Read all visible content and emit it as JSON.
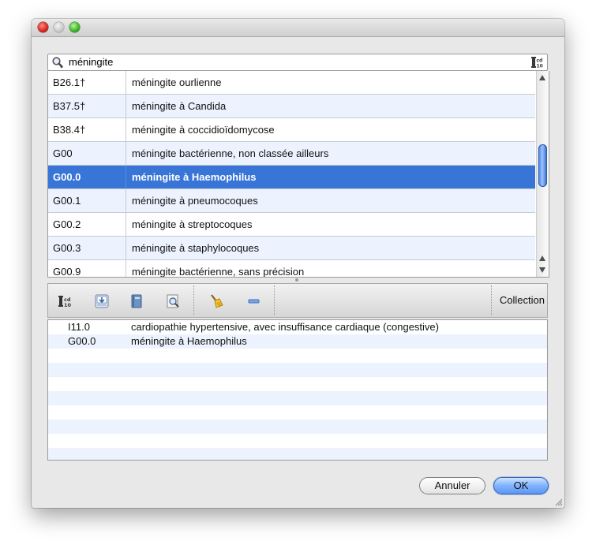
{
  "search": {
    "value": "méningite",
    "left_icon": "search-icon",
    "right_icon": "icd10-icon"
  },
  "results": {
    "rows": [
      {
        "code": "B26.1†",
        "description": "méningite ourlienne"
      },
      {
        "code": "B37.5†",
        "description": "méningite à Candida"
      },
      {
        "code": "B38.4†",
        "description": "méningite à coccidioïdomycose"
      },
      {
        "code": "G00",
        "description": "méningite bactérienne, non classée ailleurs"
      },
      {
        "code": "G00.0",
        "description": "méningite à Haemophilus"
      },
      {
        "code": "G00.1",
        "description": "méningite à pneumocoques"
      },
      {
        "code": "G00.2",
        "description": "méningite à streptocoques"
      },
      {
        "code": "G00.3",
        "description": "méningite à staphylocoques"
      },
      {
        "code": "G00.9",
        "description": "méningite bactérienne, sans précision"
      }
    ],
    "selected_index": 4,
    "selection_color": "#3875d7",
    "alternate_row_color": "#edf3fe"
  },
  "toolbar": {
    "icons": [
      "icd10-icon",
      "import-icon",
      "book-icon",
      "find-document-icon",
      "broom-icon",
      "remove-icon"
    ],
    "collection_label": "Collection"
  },
  "collection": {
    "rows": [
      {
        "code": "I11.0",
        "description": "cardiopathie hypertensive, avec insuffisance cardiaque (congestive)"
      },
      {
        "code": "G00.0",
        "description": "méningite à Haemophilus"
      }
    ]
  },
  "buttons": {
    "cancel_label": "Annuler",
    "ok_label": "OK"
  }
}
